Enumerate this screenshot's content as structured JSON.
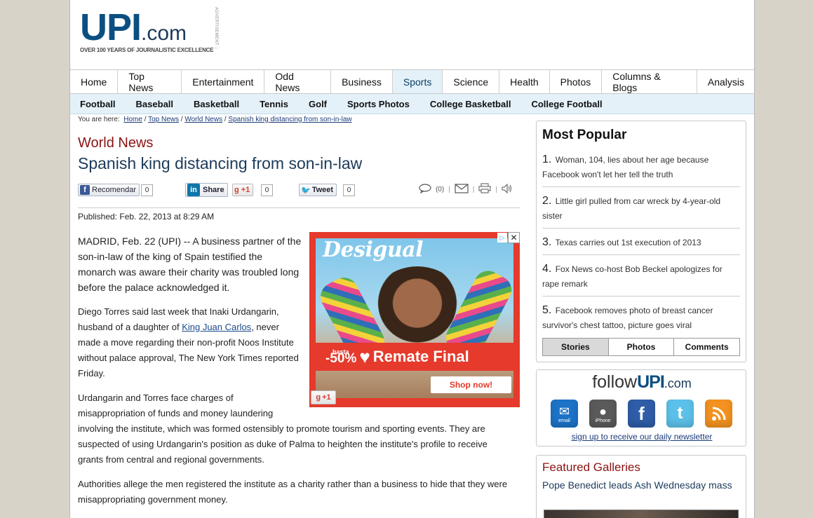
{
  "header": {
    "logo_upi": "UPI",
    "logo_com": ".com",
    "tagline": "OVER 100 YEARS OF JOURNALISTIC EXCELLENCE",
    "advertisement_label": "ADVERTISEMENT ↓"
  },
  "main_nav": [
    "Home",
    "Top News",
    "Entertainment",
    "Odd News",
    "Business",
    "Sports",
    "Science",
    "Health",
    "Photos",
    "Columns & Blogs",
    "Analysis"
  ],
  "main_nav_active": "Sports",
  "sub_nav": [
    "Football",
    "Baseball",
    "Basketball",
    "Tennis",
    "Golf",
    "Sports Photos",
    "College Basketball",
    "College Football"
  ],
  "breadcrumb": {
    "prefix": "You are here:",
    "items": [
      "Home",
      "Top News",
      "World News",
      "Spanish king distancing from son-in-law"
    ],
    "sep": "/"
  },
  "article": {
    "section": "World News",
    "headline": "Spanish king distancing from son-in-law",
    "published": "Published: Feb. 22, 2013 at 8:29 AM",
    "p1": "MADRID, Feb. 22 (UPI) -- A business partner of the son-in-law of the king of Spain testified the monarch was aware their charity was troubled long before the palace acknowledged it.",
    "p2_a": "Diego Torres said last week that Inaki Urdangarin, husband of a daughter of ",
    "p2_link": "King Juan Carlos",
    "p2_b": ", never made a move regarding their non-profit Noos Institute without palace approval, The New York Times reported Friday.",
    "p3": "Urdangarin and Torres face charges of misappropriation of funds and money laundering involving the institute, which was formed ostensibly to promote tourism and sporting events. They are suspected of using Urdangarin's position as duke of Palma to heighten the institute's profile to receive grants from central and regional governments.",
    "p4": "Authorities allege the men registered the institute as a charity rather than a business to hide that they were misappropriating government money."
  },
  "share": {
    "fb_label": "Recomendar",
    "fb_count": "0",
    "li_label": "Share",
    "gplus_label": "+1",
    "gplus_count": "0",
    "tweet_label": "Tweet",
    "tweet_count": "0",
    "comments_count": "(0)"
  },
  "ad": {
    "brand": "Desigual",
    "hasta": "hasta",
    "discount": "-50%",
    "headline": "Remate Final",
    "cta": "Shop now!",
    "close": "✕",
    "gplus": "+1"
  },
  "most_popular": {
    "title": "Most Popular",
    "items": [
      {
        "num": "1.",
        "text": "Woman, 104, lies about her age because Facebook won't let her tell the truth"
      },
      {
        "num": "2.",
        "text": "Little girl pulled from car wreck by 4-year-old sister"
      },
      {
        "num": "3.",
        "text": "Texas carries out 1st execution of 2013"
      },
      {
        "num": "4.",
        "text": "Fox News co-host Bob Beckel apologizes for rape remark"
      },
      {
        "num": "5.",
        "text": "Facebook removes photo of breast cancer survivor's chest tattoo, picture goes viral"
      }
    ],
    "tabs": [
      "Stories",
      "Photos",
      "Comments"
    ],
    "active_tab": "Stories"
  },
  "follow": {
    "follow_word": "follow",
    "upi": "UPI",
    "com": ".com",
    "icons": [
      {
        "name": "email-icon",
        "label": "email"
      },
      {
        "name": "iphone-icon",
        "label": "iPhone"
      },
      {
        "name": "facebook-icon",
        "label": ""
      },
      {
        "name": "twitter-icon",
        "label": ""
      },
      {
        "name": "rss-icon",
        "label": ""
      }
    ],
    "newsletter": "sign up to receive our daily newsletter"
  },
  "featured_galleries": {
    "title": "Featured Galleries",
    "item_title": "Pope Benedict leads Ash Wednesday mass"
  },
  "colors": {
    "brand_blue": "#0b4f82",
    "section_red": "#8b1313",
    "nav_active_bg": "#e4f1f8",
    "ad_red": "#e53a2c"
  }
}
